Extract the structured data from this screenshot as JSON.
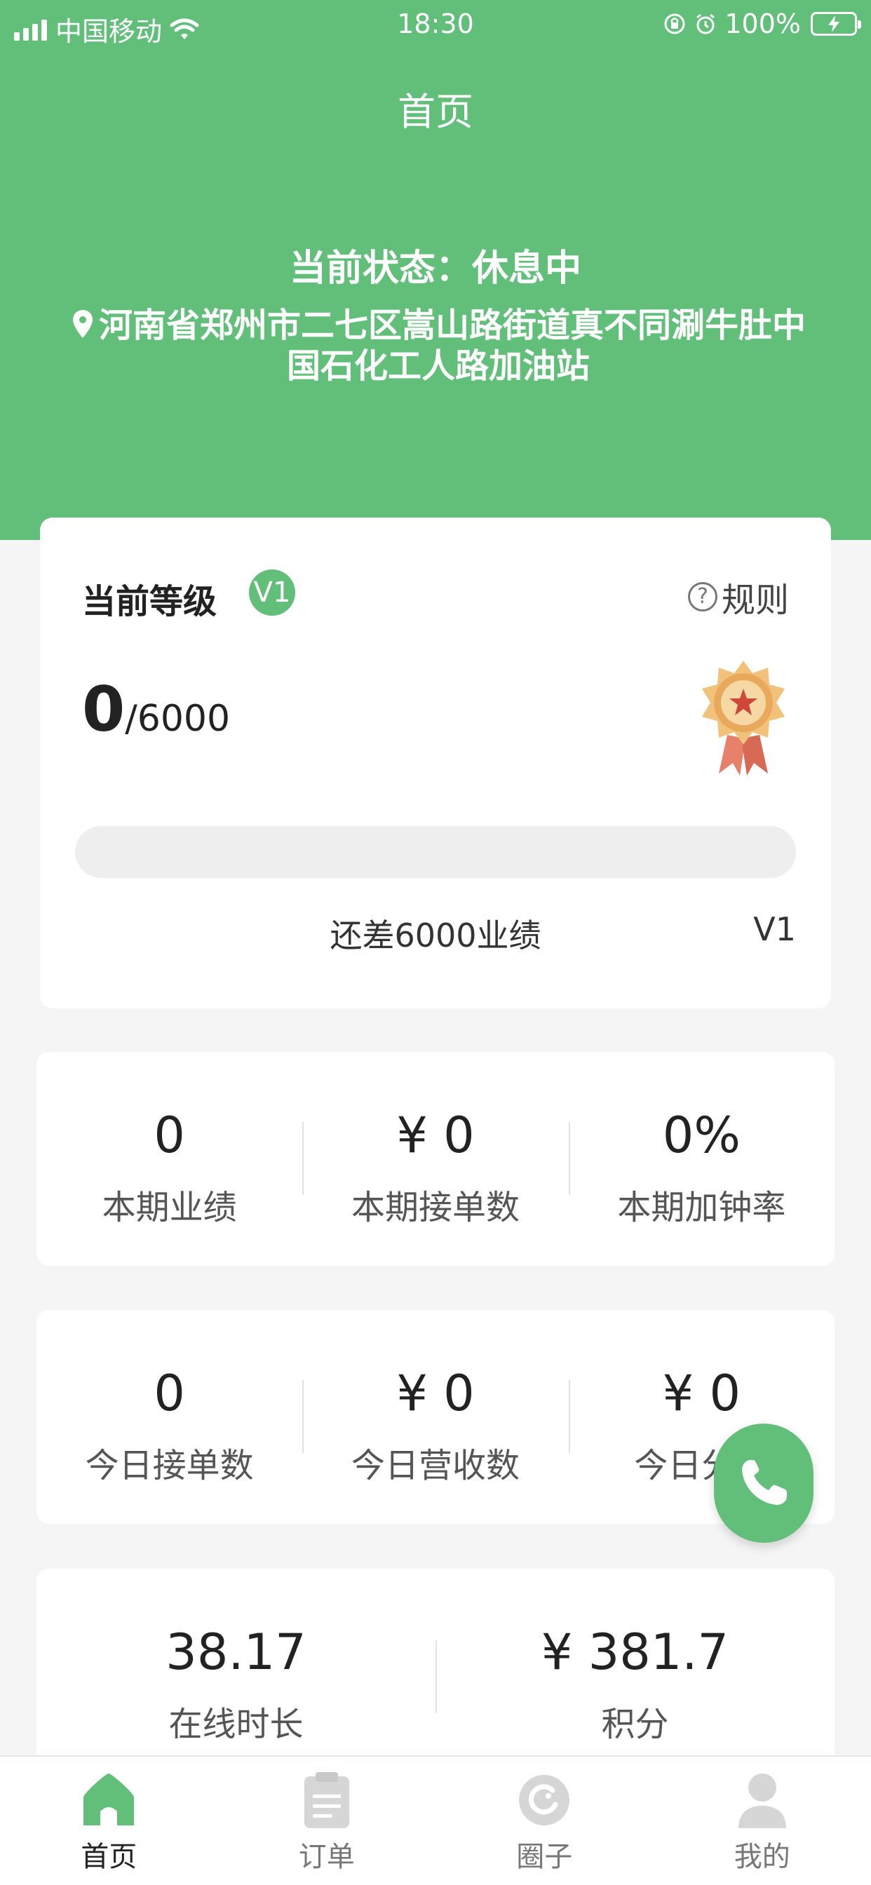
{
  "status_bar": {
    "carrier": "中国移动",
    "time": "18:30",
    "battery": "100%"
  },
  "header": {
    "title": "首页",
    "state_text": "当前状态：休息中",
    "address": "河南省郑州市二七区嵩山路街道真不同涮牛肚中国石化工人路加油站"
  },
  "level_card": {
    "label": "当前等级",
    "badge": "V1",
    "rule_label": "规则",
    "current": "0",
    "total": "/6000",
    "progress": 0,
    "remain_text": "还差6000业绩",
    "next_level": "V1"
  },
  "period_stats": [
    {
      "value": "0",
      "label": "本期业绩"
    },
    {
      "value": "¥ 0",
      "label": "本期接单数"
    },
    {
      "value": "0%",
      "label": "本期加钟率"
    }
  ],
  "today_stats": [
    {
      "value": "0",
      "label": "今日接单数"
    },
    {
      "value": "¥ 0",
      "label": "今日营收数"
    },
    {
      "value": "¥ 0",
      "label": "今日分成"
    }
  ],
  "online_stats": [
    {
      "value": "38.17",
      "label": "在线时长"
    },
    {
      "value": "¥ 381.7",
      "label": "积分"
    }
  ],
  "tabs": [
    {
      "label": "首页",
      "icon": "home-icon",
      "active": true
    },
    {
      "label": "订单",
      "icon": "order-icon",
      "active": false
    },
    {
      "label": "圈子",
      "icon": "circle-icon",
      "active": false
    },
    {
      "label": "我的",
      "icon": "profile-icon",
      "active": false
    }
  ],
  "colors": {
    "primary": "#61bf7a",
    "background": "#f5f5f5",
    "progress_track": "#eeeeee"
  }
}
